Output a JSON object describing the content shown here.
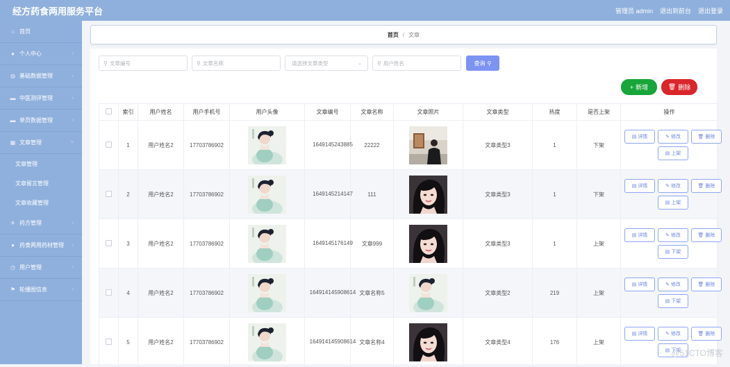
{
  "header": {
    "title": "经方药食两用服务平台",
    "admin": "管理员 admin",
    "to_front": "退出到前台",
    "logout": "退出登录"
  },
  "sidebar": {
    "items": [
      {
        "label": "首页",
        "icon": "home-icon"
      },
      {
        "label": "个人中心",
        "icon": "user-icon"
      },
      {
        "label": "基础数据管理",
        "icon": "globe-icon"
      },
      {
        "label": "中医测评管理",
        "icon": "card-icon"
      },
      {
        "label": "单页数据管理",
        "icon": "card-icon"
      },
      {
        "label": "文章管理",
        "icon": "grid-icon"
      }
    ],
    "subitems": [
      "文章管理",
      "文章留言管理",
      "文章收藏管理"
    ],
    "items2": [
      {
        "label": "药方管理",
        "icon": "plane-icon"
      },
      {
        "label": "药食两用药材管理",
        "icon": "pin-icon"
      },
      {
        "label": "用户管理",
        "icon": "clock-icon"
      },
      {
        "label": "轮播图信息",
        "icon": "flag-icon"
      }
    ]
  },
  "breadcrumb": {
    "home": "首页",
    "sep": "/",
    "current": "文章"
  },
  "search": {
    "number_placeholder": "文章编号",
    "name_placeholder": "文章名称",
    "type_placeholder": "请选择文章类型",
    "user_placeholder": "用户姓名",
    "query_label": "查询"
  },
  "actions": {
    "add_label": "新增",
    "delete_label": "删除"
  },
  "table": {
    "headers": [
      "索引",
      "用户姓名",
      "用户手机号",
      "用户头像",
      "文章编号",
      "文章名称",
      "文章照片",
      "文章类型",
      "热度",
      "是否上架",
      "操作"
    ],
    "rows": [
      {
        "index": "1",
        "user": "用户姓名2",
        "phone": "17703786902",
        "number": "1649145243885",
        "name": "22222",
        "photo": "man",
        "type": "文章类型3",
        "heat": "1",
        "status": "下架",
        "toggle": "上架"
      },
      {
        "index": "2",
        "user": "用户姓名2",
        "phone": "17703786902",
        "number": "1649145214147",
        "name": "111",
        "photo": "girl",
        "type": "文章类型3",
        "heat": "1",
        "status": "下架",
        "toggle": "上架"
      },
      {
        "index": "3",
        "user": "用户姓名2",
        "phone": "17703786902",
        "number": "1649145176149",
        "name": "文章999",
        "photo": "girl",
        "type": "文章类型3",
        "heat": "1",
        "status": "上架",
        "toggle": "下架"
      },
      {
        "index": "4",
        "user": "用户姓名2",
        "phone": "17703786902",
        "number": "1649141459086​14",
        "name": "文章名称5",
        "photo": "lady",
        "type": "文章类型2",
        "heat": "219",
        "status": "上架",
        "toggle": "下架"
      },
      {
        "index": "5",
        "user": "用户姓名2",
        "phone": "17703786902",
        "number": "16491414590​8614",
        "name": "文章名称4",
        "photo": "girl",
        "type": "文章类型4",
        "heat": "176",
        "status": "上架",
        "toggle": "下架"
      }
    ],
    "op_detail": "详情",
    "op_edit": "修改",
    "op_delete": "删除"
  },
  "watermark": "@51CTO博客",
  "colors": {
    "topbar": "#8fb0dc",
    "query": "#7d93f2",
    "add": "#18a53a",
    "delete": "#d9262b"
  }
}
